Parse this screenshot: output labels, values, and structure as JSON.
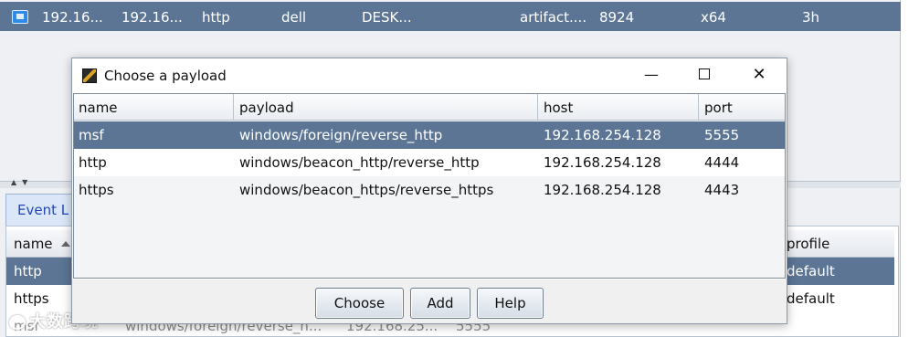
{
  "session": {
    "external": "192.16...",
    "internal": "192.16...",
    "listener": "http",
    "user": "dell",
    "computer": "DESK...",
    "process": "artifact....",
    "pid": "8924",
    "arch": "x64",
    "last": "3h"
  },
  "lower": {
    "tab_label": "Event L",
    "headers": {
      "name": "name",
      "profile": "profile"
    },
    "rows": [
      {
        "name": "http",
        "profile": "default"
      },
      {
        "name": "https",
        "profile": "default"
      }
    ],
    "ghost_row": {
      "name": "msf",
      "payload": "windows/foreign/reverse_h...",
      "host": "192.168.25...",
      "port": "5555"
    },
    "watermark": "大数跨境"
  },
  "dialog": {
    "title": "Choose a payload",
    "minimize": "—",
    "close": "✕",
    "columns": {
      "name": "name",
      "payload": "payload",
      "host": "host",
      "port": "port"
    },
    "rows": [
      {
        "name": "msf",
        "payload": "windows/foreign/reverse_http",
        "host": "192.168.254.128",
        "port": "5555"
      },
      {
        "name": "http",
        "payload": "windows/beacon_http/reverse_http",
        "host": "192.168.254.128",
        "port": "4444"
      },
      {
        "name": "https",
        "payload": "windows/beacon_https/reverse_https",
        "host": "192.168.254.128",
        "port": "4443"
      }
    ],
    "buttons": {
      "choose": "Choose",
      "add": "Add",
      "help": "Help"
    }
  }
}
